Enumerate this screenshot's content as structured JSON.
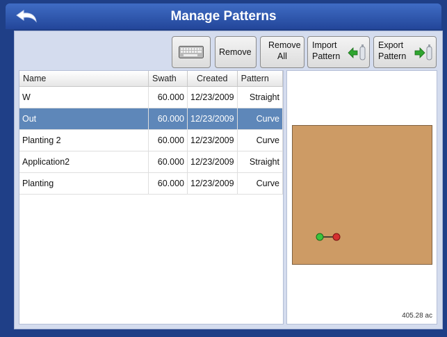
{
  "window": {
    "title": "Manage Patterns"
  },
  "toolbar": {
    "keyboard_icon": "keyboard-icon",
    "remove_label": "Remove",
    "remove_all_label_line1": "Remove",
    "remove_all_label_line2": "All",
    "import_label_line1": "Import",
    "import_label_line2": "Pattern",
    "export_label_line1": "Export",
    "export_label_line2": "Pattern"
  },
  "table": {
    "headers": [
      "Name",
      "Swath",
      "Created",
      "Pattern"
    ],
    "rows": [
      {
        "name": "W",
        "swath": "60.000",
        "created": "12/23/2009",
        "pattern": "Straight"
      },
      {
        "name": "Out",
        "swath": "60.000",
        "created": "12/23/2009",
        "pattern": "Curve"
      },
      {
        "name": "Planting 2",
        "swath": "60.000",
        "created": "12/23/2009",
        "pattern": "Curve"
      },
      {
        "name": "Application2",
        "swath": "60.000",
        "created": "12/23/2009",
        "pattern": "Straight"
      },
      {
        "name": "Planting",
        "swath": "60.000",
        "created": "12/23/2009",
        "pattern": "Curve"
      }
    ],
    "selected_row": "Out"
  },
  "preview": {
    "area_text": "405.28 ac"
  },
  "colors": {
    "selection": "#5e87b9",
    "field": "#cd9b65",
    "title_bar": "#2f58b0"
  }
}
